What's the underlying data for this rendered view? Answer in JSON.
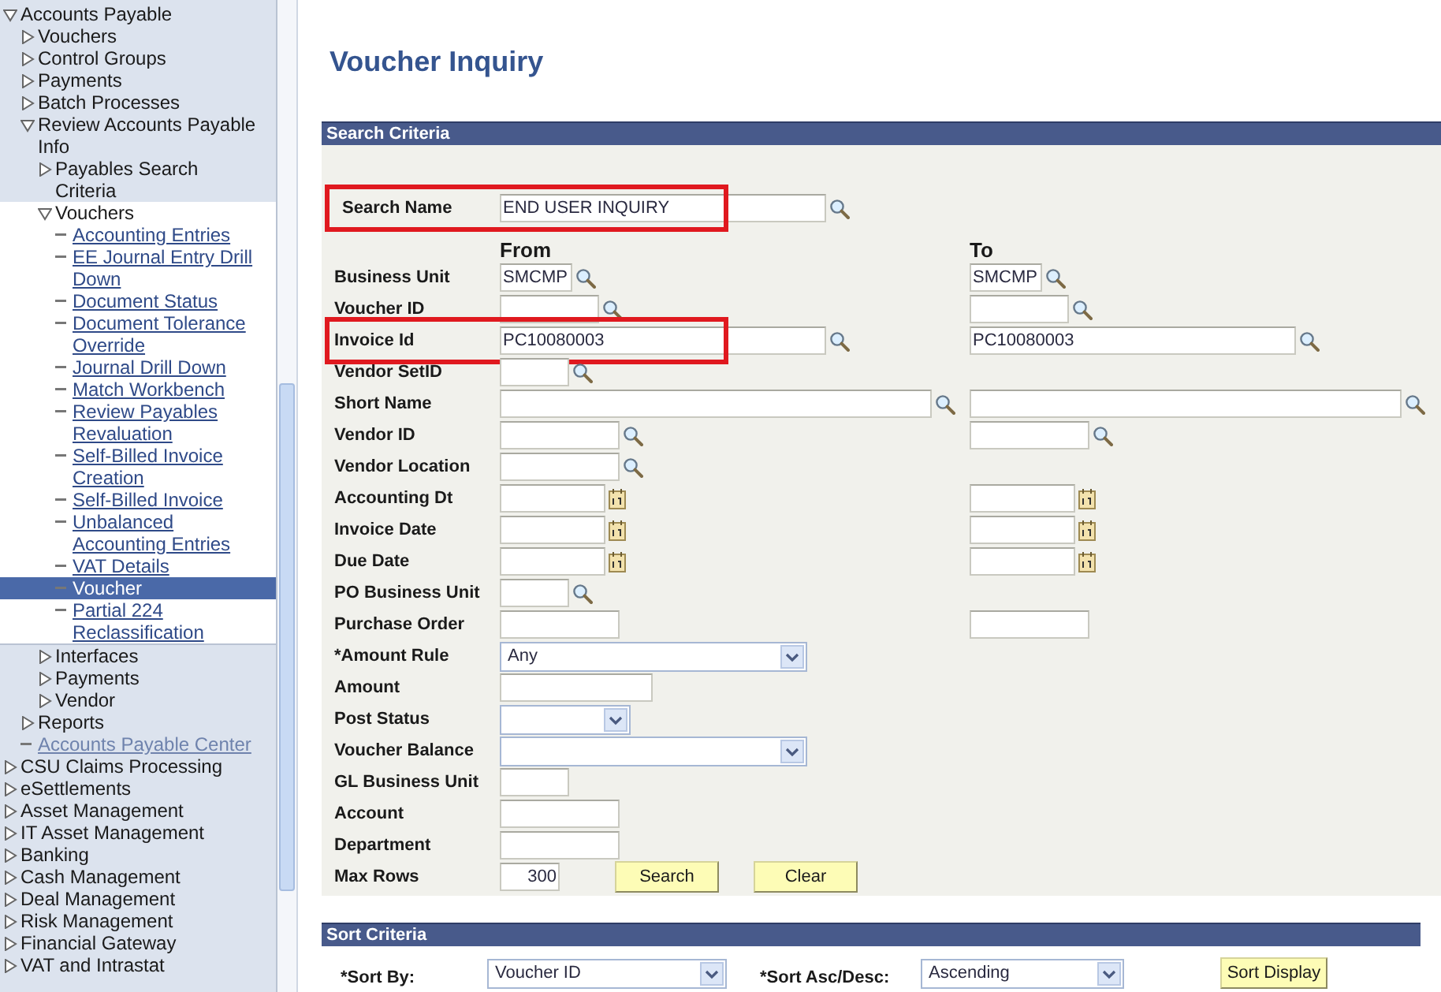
{
  "sidebar": {
    "items": [
      {
        "label": "Accounts Payable",
        "kind": "folder",
        "expanded": true,
        "children": [
          {
            "label": "Vouchers",
            "kind": "folder",
            "expanded": false
          },
          {
            "label": "Control Groups",
            "kind": "folder",
            "expanded": false
          },
          {
            "label": "Payments",
            "kind": "folder",
            "expanded": false
          },
          {
            "label": "Batch Processes",
            "kind": "folder",
            "expanded": false
          },
          {
            "label": "Review Accounts Payable Info",
            "kind": "folder",
            "expanded": true,
            "children": [
              {
                "label": "Payables Search Criteria",
                "kind": "folder",
                "expanded": false
              },
              {
                "label": "Vouchers",
                "kind": "folder",
                "expanded": true,
                "children": [
                  {
                    "label": "Accounting Entries",
                    "kind": "link",
                    "selected": false
                  },
                  {
                    "label": "EE Journal Entry Drill Down",
                    "kind": "link",
                    "selected": false
                  },
                  {
                    "label": "Document Status",
                    "kind": "link",
                    "selected": false
                  },
                  {
                    "label": "Document Tolerance Override",
                    "kind": "link",
                    "selected": false
                  },
                  {
                    "label": "Journal Drill Down",
                    "kind": "link",
                    "selected": false
                  },
                  {
                    "label": "Match Workbench",
                    "kind": "link",
                    "selected": false
                  },
                  {
                    "label": "Review Payables Revaluation",
                    "kind": "link",
                    "selected": false
                  },
                  {
                    "label": "Self-Billed Invoice Creation",
                    "kind": "link",
                    "selected": false
                  },
                  {
                    "label": "Self-Billed Invoice",
                    "kind": "link",
                    "selected": false
                  },
                  {
                    "label": "Unbalanced Accounting Entries",
                    "kind": "link",
                    "selected": false
                  },
                  {
                    "label": "VAT Details",
                    "kind": "link",
                    "selected": false
                  },
                  {
                    "label": "Voucher",
                    "kind": "link",
                    "selected": true
                  },
                  {
                    "label": "Partial 224 Reclassification",
                    "kind": "link",
                    "selected": false
                  }
                ]
              },
              {
                "label": "Interfaces",
                "kind": "folder",
                "expanded": false
              },
              {
                "label": "Payments",
                "kind": "folder",
                "expanded": false
              },
              {
                "label": "Vendor",
                "kind": "folder",
                "expanded": false
              }
            ]
          },
          {
            "label": "Reports",
            "kind": "folder",
            "expanded": false
          },
          {
            "label": "Accounts Payable Center",
            "kind": "link",
            "selected": false
          }
        ]
      },
      {
        "label": "CSU Claims Processing",
        "kind": "folder",
        "expanded": false
      },
      {
        "label": "eSettlements",
        "kind": "folder",
        "expanded": false
      },
      {
        "label": "Asset Management",
        "kind": "folder",
        "expanded": false
      },
      {
        "label": "IT Asset Management",
        "kind": "folder",
        "expanded": false
      },
      {
        "label": "Banking",
        "kind": "folder",
        "expanded": false
      },
      {
        "label": "Cash Management",
        "kind": "folder",
        "expanded": false
      },
      {
        "label": "Deal Management",
        "kind": "folder",
        "expanded": false
      },
      {
        "label": "Risk Management",
        "kind": "folder",
        "expanded": false
      },
      {
        "label": "Financial Gateway",
        "kind": "folder",
        "expanded": false
      },
      {
        "label": "VAT and Intrastat",
        "kind": "folder",
        "expanded": false
      }
    ]
  },
  "page": {
    "title": "Voucher Inquiry"
  },
  "search_criteria": {
    "title": "Search Criteria",
    "search_name": {
      "label": "Search Name",
      "kind": "lookup",
      "value": "END USER INQUIRY",
      "highlighted": true
    },
    "from_heading": "From",
    "to_heading": "To",
    "fields": [
      {
        "label": "Business Unit",
        "kind": "lookup",
        "range": true,
        "value": "SMCMP",
        "to_value": "SMCMP",
        "highlighted": false
      },
      {
        "label": "Voucher ID",
        "kind": "lookup",
        "range": true,
        "highlighted": false
      },
      {
        "label": "Invoice Id",
        "kind": "lookup",
        "range": true,
        "value": "PC10080003",
        "to_value": "PC10080003",
        "highlighted": true
      },
      {
        "label": "Vendor SetID",
        "kind": "lookup",
        "range": false,
        "highlighted": false
      },
      {
        "label": "Short Name",
        "kind": "lookup",
        "range": true,
        "highlighted": false
      },
      {
        "label": "Vendor ID",
        "kind": "lookup",
        "range": true,
        "highlighted": false
      },
      {
        "label": "Vendor Location",
        "kind": "lookup",
        "range": false,
        "highlighted": false
      },
      {
        "label": "Accounting Dt",
        "kind": "date",
        "range": true,
        "highlighted": false
      },
      {
        "label": "Invoice Date",
        "kind": "date",
        "range": true,
        "highlighted": false
      },
      {
        "label": "Due Date",
        "kind": "date",
        "range": true,
        "highlighted": false
      },
      {
        "label": "PO Business Unit",
        "kind": "lookup",
        "range": false,
        "highlighted": false
      },
      {
        "label": "Purchase Order",
        "kind": "text",
        "range": true,
        "highlighted": false
      },
      {
        "label": "*Amount Rule",
        "kind": "select",
        "range": false,
        "value": "Any",
        "highlighted": false
      },
      {
        "label": "Amount",
        "kind": "text",
        "range": false,
        "highlighted": false
      },
      {
        "label": "Post Status",
        "kind": "select",
        "range": false,
        "highlighted": false
      },
      {
        "label": "Voucher Balance",
        "kind": "select",
        "range": false,
        "highlighted": false
      },
      {
        "label": "GL Business Unit",
        "kind": "text",
        "range": false,
        "highlighted": false
      },
      {
        "label": "Account",
        "kind": "text",
        "range": false,
        "highlighted": false
      },
      {
        "label": "Department",
        "kind": "text",
        "range": false,
        "highlighted": false
      }
    ],
    "max_rows": {
      "label": "Max Rows",
      "value": "300"
    },
    "buttons": [
      "Search",
      "Clear"
    ]
  },
  "sort_criteria": {
    "title": "Sort Criteria",
    "sort_by": {
      "label": "*Sort By:",
      "value": "Voucher ID"
    },
    "sort_order": {
      "label": "*Sort Asc/Desc:",
      "value": "Ascending"
    },
    "button": "Sort Display"
  }
}
